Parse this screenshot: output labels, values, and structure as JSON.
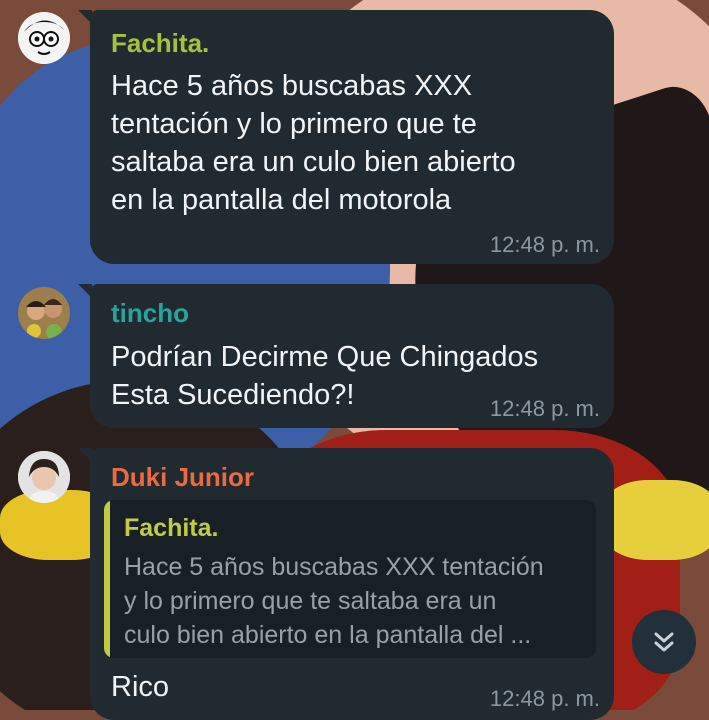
{
  "messages": [
    {
      "sender": "Fachita.",
      "sender_color": "#a6c23b",
      "text": "Hace 5 años buscabas XXX\ntentación y lo primero que te\nsaltaba era un culo bien abierto\nen la pantalla del motorola",
      "time": "12:48 p. m."
    },
    {
      "sender": "tincho",
      "sender_color": "#26a69a",
      "text": "Podrían Decirme Que Chingados\nEsta Sucediendo?!",
      "time": "12:48 p. m."
    },
    {
      "sender": "Duki Junior",
      "sender_color": "#ec6a3d",
      "reply": {
        "sender": "Fachita.",
        "text": "Hace 5 años buscabas XXX tentación\ny lo primero que te saltaba era un\nculo bien abierto en la pantalla del ..."
      },
      "text": "Rico",
      "time": "12:48 p. m."
    }
  ],
  "scroll_button": {
    "icon": "double-chevron-down-icon"
  }
}
